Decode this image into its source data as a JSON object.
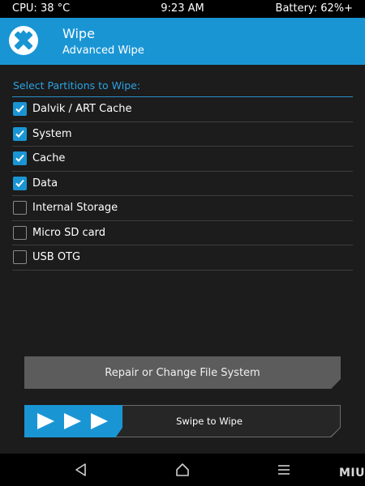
{
  "status_bar": {
    "cpu": "CPU: 38 °C",
    "time": "9:23 AM",
    "battery": "Battery: 62%+"
  },
  "header": {
    "title": "Wipe",
    "subtitle": "Advanced Wipe",
    "logo_icon": "twrp-logo-icon",
    "accent_color": "#1a95d4"
  },
  "partitions": {
    "label": "Select Partitions to Wipe:",
    "items": [
      {
        "label": "Dalvik / ART Cache",
        "checked": true
      },
      {
        "label": "System",
        "checked": true
      },
      {
        "label": "Cache",
        "checked": true
      },
      {
        "label": "Data",
        "checked": true
      },
      {
        "label": "Internal Storage",
        "checked": false
      },
      {
        "label": "Micro SD card",
        "checked": false
      },
      {
        "label": "USB OTG",
        "checked": false
      }
    ]
  },
  "actions": {
    "repair_label": "Repair or Change File System",
    "swipe_label": "Swipe to Wipe"
  },
  "navbar": {
    "back_icon": "back-icon",
    "home_icon": "home-icon",
    "menu_icon": "menu-icon"
  },
  "watermark": "MIUI"
}
